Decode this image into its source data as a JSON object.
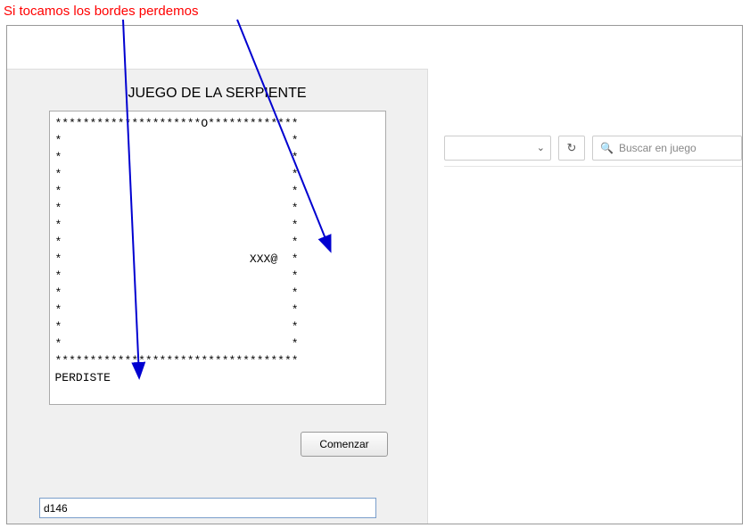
{
  "annotation": "Si tocamos los bordes perdemos",
  "game": {
    "title": "JUEGO DE LA SERPIENTE",
    "board_lines": [
      "*********************O*************",
      "*                                 *",
      "*                                 *",
      "*                                 *",
      "*                                 *",
      "*                                 *",
      "*                                 *",
      "*                                 *",
      "*                           XXX@  *",
      "*                                 *",
      "*                                 *",
      "*                                 *",
      "*                                 *",
      "*                                 *",
      "***********************************",
      "PERDISTE"
    ],
    "start_button": "Comenzar",
    "input_value": "d146"
  },
  "toolbar": {
    "search_placeholder": "Buscar en juego"
  }
}
